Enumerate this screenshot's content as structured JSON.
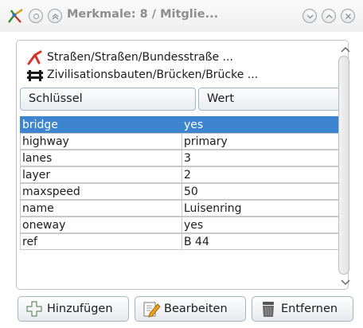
{
  "window": {
    "title": "Merkmale: 8 / Mitglie..."
  },
  "features": [
    {
      "icon": "road-icon",
      "label": "Straßen/Straßen/Bundesstraße ..."
    },
    {
      "icon": "bridge-icon",
      "label": "Zivilisationsbauten/Brücken/Brücke ..."
    }
  ],
  "table": {
    "headers": {
      "key": "Schlüssel",
      "value": "Wert"
    },
    "rows": [
      {
        "key": "bridge",
        "value": "yes",
        "selected": true
      },
      {
        "key": "highway",
        "value": "primary"
      },
      {
        "key": "lanes",
        "value": "3"
      },
      {
        "key": "layer",
        "value": "2"
      },
      {
        "key": "maxspeed",
        "value": "50"
      },
      {
        "key": "name",
        "value": "Luisenring"
      },
      {
        "key": "oneway",
        "value": "yes"
      },
      {
        "key": "ref",
        "value": "B 44"
      }
    ]
  },
  "buttons": {
    "add": "Hinzufügen",
    "edit": "Bearbeiten",
    "delete": "Entfernen"
  },
  "colors": {
    "selection": "#3d86cf",
    "title_text": "#8e8e8e"
  }
}
